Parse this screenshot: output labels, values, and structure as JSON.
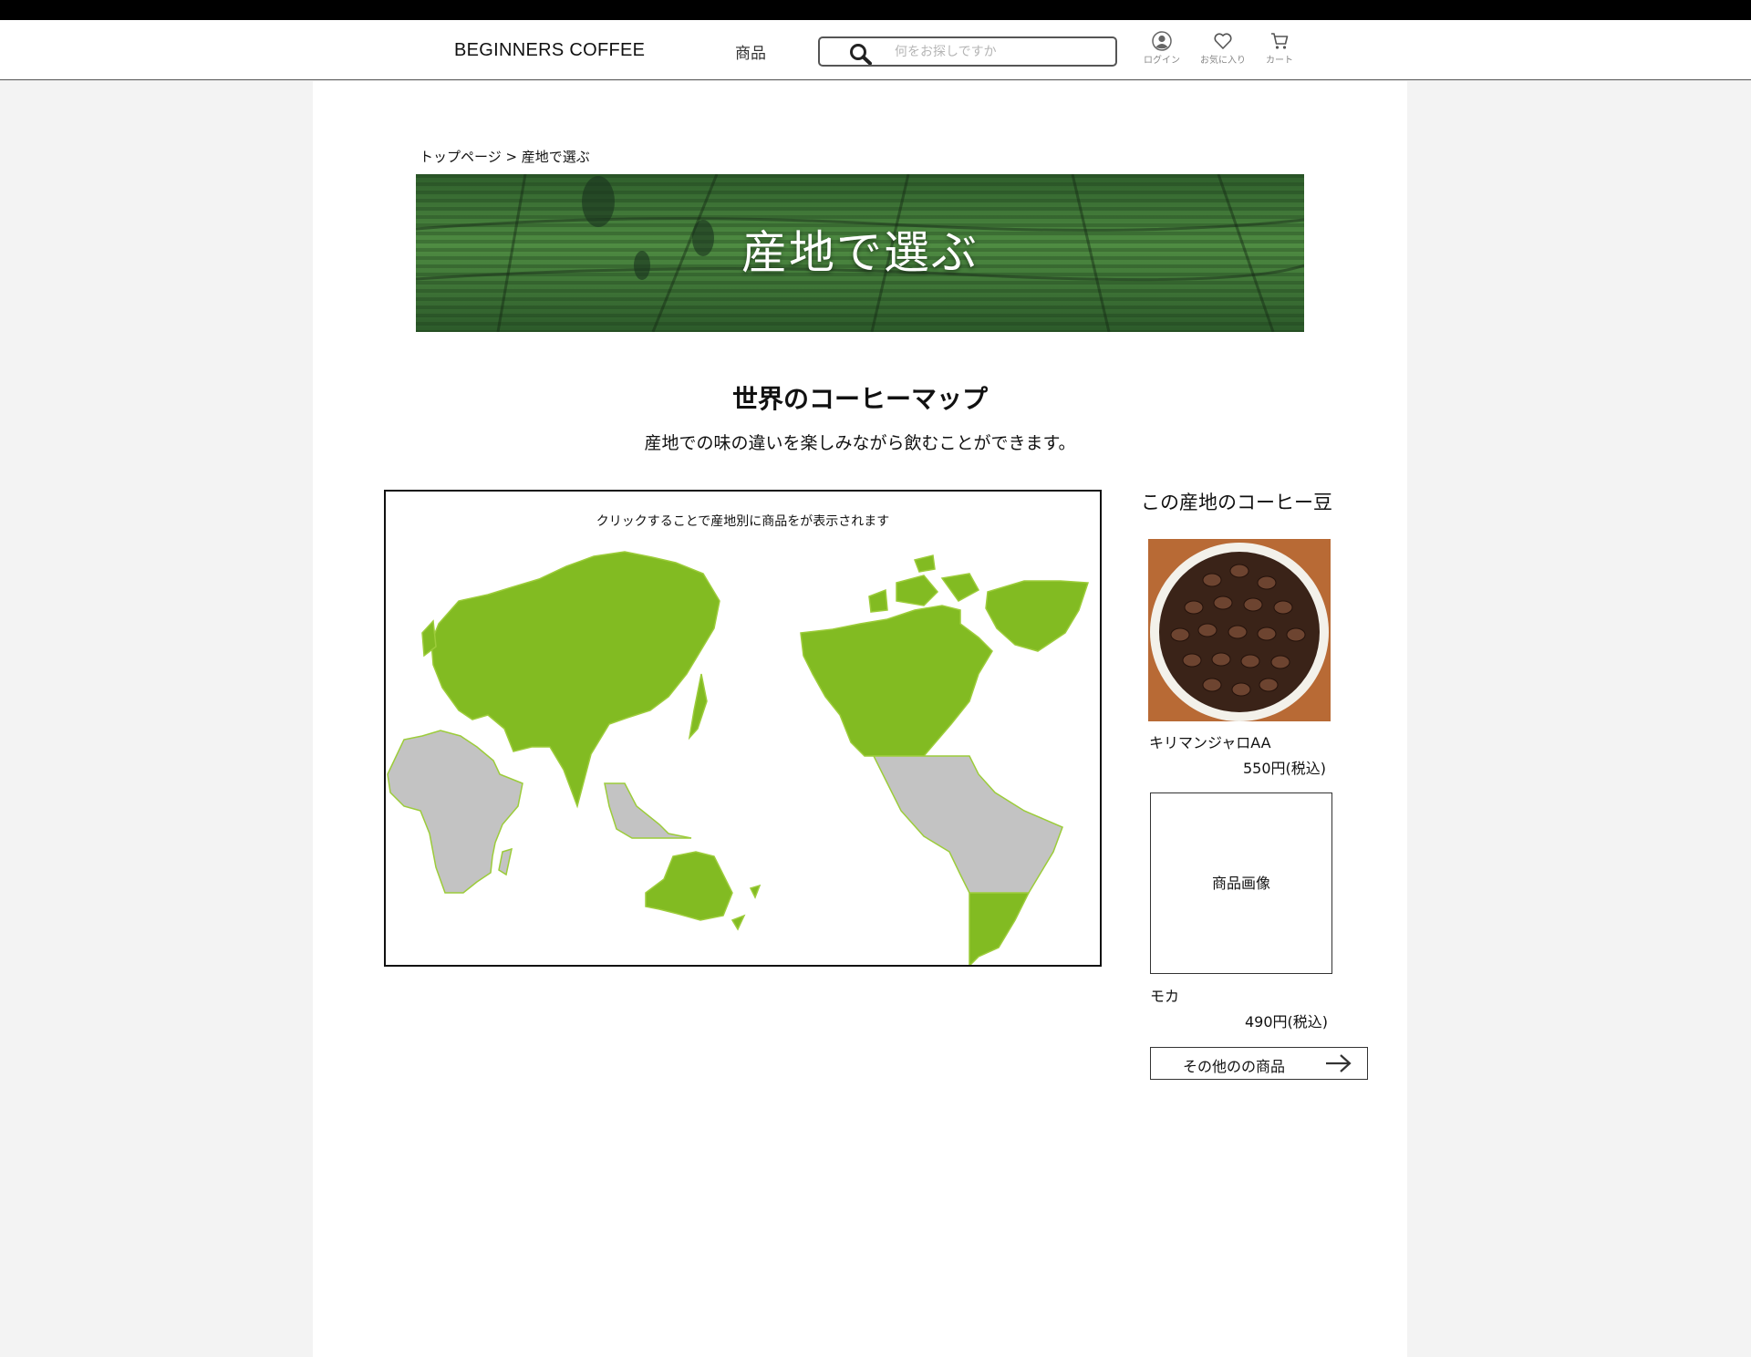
{
  "header": {
    "brand": "BEGINNERS COFFEE",
    "nav_products": "商品",
    "search_placeholder": "何をお探しですか",
    "icons": {
      "login": "ログイン",
      "favorites": "お気に入り",
      "cart": "カート"
    }
  },
  "breadcrumb": "トップページ > 産地で選ぶ",
  "hero": {
    "title": "産地で選ぶ"
  },
  "section": {
    "title": "世界のコーヒーマップ",
    "subtitle": "産地での味の違いを楽しみながら飲むことができます。"
  },
  "map": {
    "note": "クリックすることで産地別に商品をが表示されます"
  },
  "sidebar": {
    "title": "この産地のコーヒー豆",
    "products": [
      {
        "name": "キリマンジャロAA",
        "price": "550円(税込)",
        "image_icon": "coffee-beans-photo"
      },
      {
        "name": "モカ",
        "price": "490円(税込)",
        "image_placeholder": "商品画像"
      }
    ],
    "more_button": "その他のの商品"
  },
  "colors": {
    "land": "#82bb22",
    "coffee_belt": "#c3c3c3",
    "hero_green": "#3f7a37"
  }
}
